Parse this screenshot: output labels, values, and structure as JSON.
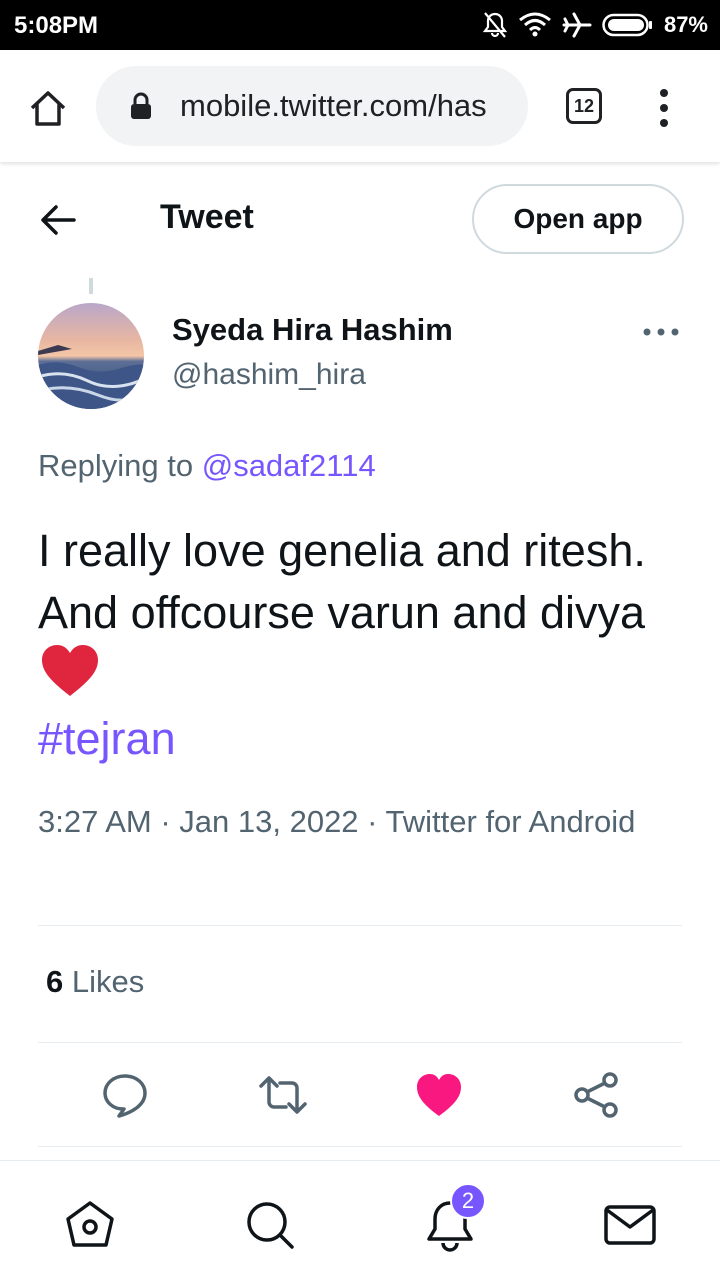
{
  "status_bar": {
    "time": "5:08PM",
    "battery": "87%"
  },
  "browser": {
    "url": "mobile.twitter.com/has",
    "tab_count": "12"
  },
  "header": {
    "title": "Tweet",
    "open_app": "Open app"
  },
  "tweet": {
    "author_name": "Syeda Hira Hashim",
    "author_handle": "@hashim_hira",
    "replying_prefix": "Replying to ",
    "replying_to": "@sadaf2114",
    "text": "I really love genelia and ritesh. And offcourse varun and divya",
    "hashtag": "#tejran",
    "meta": "3:27 AM · Jan 13, 2022 · Twitter for Android",
    "likes_count": "6",
    "likes_label": " Likes"
  },
  "colors": {
    "accent": "#7856ff",
    "like": "#f91880",
    "text": "#0f1419",
    "secondary": "#536471"
  },
  "notifications_badge": "2"
}
